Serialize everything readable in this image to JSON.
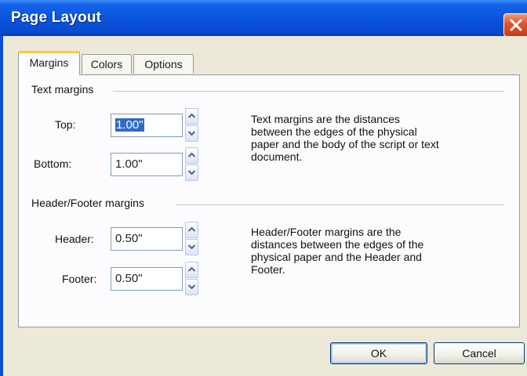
{
  "window": {
    "title": "Page Layout"
  },
  "tabs": [
    {
      "label": "Margins",
      "active": true
    },
    {
      "label": "Colors",
      "active": false
    },
    {
      "label": "Options",
      "active": false
    }
  ],
  "text_margins": {
    "group_label": "Text margins",
    "top": {
      "label": "Top:",
      "value": "1.00\""
    },
    "bottom": {
      "label": "Bottom:",
      "value": "1.00\""
    },
    "description": [
      "Text margins are the distances",
      "between the edges of the physical",
      "paper and the body of the script or text",
      "document."
    ]
  },
  "header_footer_margins": {
    "group_label": "Header/Footer margins",
    "header": {
      "label": "Header:",
      "value": "0.50\""
    },
    "footer": {
      "label": "Footer:",
      "value": "0.50\""
    },
    "description": [
      "Header/Footer margins are the",
      "distances between the edges of the",
      "physical paper and the Header and",
      "Footer."
    ]
  },
  "buttons": {
    "ok": "OK",
    "cancel": "Cancel"
  },
  "colors": {
    "titlebar": "#0a55de",
    "selection": "#316ac5",
    "active_tab_accent": "#ffc83c"
  }
}
